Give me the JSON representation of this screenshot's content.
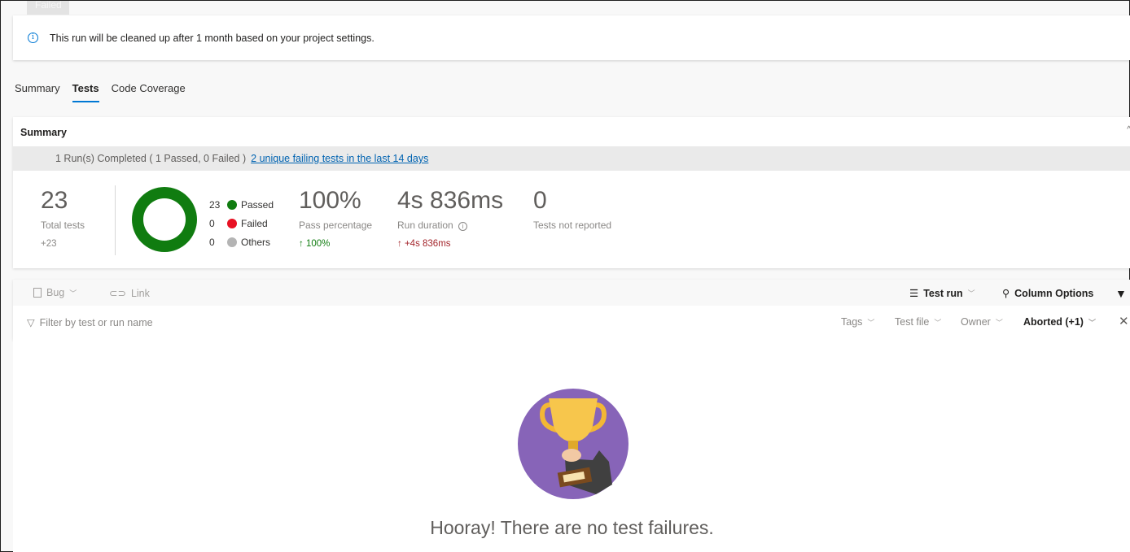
{
  "status_chip": "Failed",
  "banner": {
    "text": "This run will be cleaned up after 1 month based on your project settings."
  },
  "tabs": [
    {
      "label": "Summary",
      "active": false
    },
    {
      "label": "Tests",
      "active": true
    },
    {
      "label": "Code Coverage",
      "active": false
    }
  ],
  "summary": {
    "title": "Summary",
    "run_status": "1 Run(s) Completed ( 1 Passed, 0 Failed )",
    "failing_link": "2 unique failing tests in the last 14 days",
    "total_tests": {
      "value": "23",
      "label": "Total tests",
      "delta": "+23"
    },
    "legend": [
      {
        "count": "23",
        "label": "Passed",
        "color": "#107c10"
      },
      {
        "count": "0",
        "label": "Failed",
        "color": "#e81123"
      },
      {
        "count": "0",
        "label": "Others",
        "color": "#b4b4b4"
      }
    ],
    "pass_percentage": {
      "value": "100%",
      "label": "Pass percentage",
      "delta": "100%"
    },
    "run_duration": {
      "value": "4s 836ms",
      "label": "Run duration",
      "delta": "+4s 836ms"
    },
    "not_reported": {
      "value": "0",
      "label": "Tests not reported"
    }
  },
  "toolbar": {
    "bug_label": "Bug",
    "link_label": "Link",
    "test_run_label": "Test run",
    "column_options_label": "Column Options"
  },
  "filters": {
    "search_placeholder": "Filter by test or run name",
    "tags": "Tags",
    "test_file": "Test file",
    "owner": "Owner",
    "outcome": "Aborted (+1)"
  },
  "empty_state": {
    "message": "Hooray! There are no test failures."
  },
  "colors": {
    "accent": "#0078d4",
    "passed": "#107c10",
    "failed": "#e81123",
    "trophy_bg": "#8764b8",
    "delta_green": "#107c10",
    "delta_red": "#a4262c"
  }
}
